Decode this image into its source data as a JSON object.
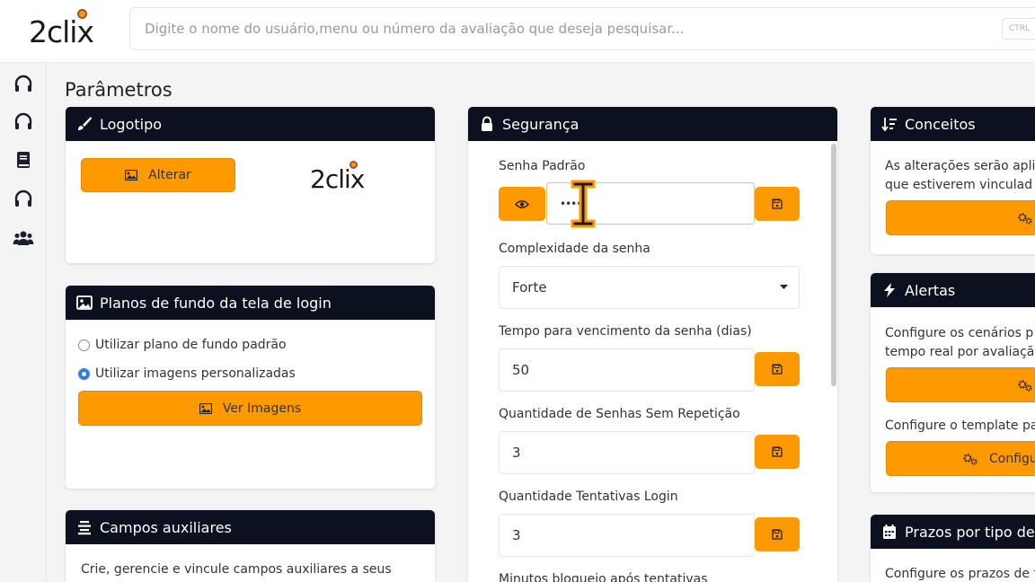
{
  "app": {
    "logo_text": "2clix",
    "search_placeholder": "Digite o nome do usuário,menu ou número da avaliação que deseja pesquisar...",
    "search_shortcut": "CTRL"
  },
  "sidebar": {
    "items": [
      {
        "icon": "headset-icon"
      },
      {
        "icon": "headset-icon"
      },
      {
        "icon": "book-icon"
      },
      {
        "icon": "headset-icon"
      },
      {
        "icon": "users-icon"
      }
    ]
  },
  "page": {
    "title": "Parâmetros"
  },
  "logotipo": {
    "title": "Logotipo",
    "alterar_label": "Alterar",
    "preview_text": "2clix"
  },
  "planos": {
    "title": "Planos de fundo da tela de login",
    "option_default": "Utilizar plano de fundo padrão",
    "option_custom": "Utilizar imagens personalizadas",
    "selected": "Utilizar imagens personalizadas",
    "ver_imagens_label": "Ver Imagens"
  },
  "campos": {
    "title": "Campos auxiliares",
    "description": "Crie, gerencie e vincule campos auxiliares a seus"
  },
  "seguranca": {
    "title": "Segurança",
    "senha_padrao_label": "Senha Padrão",
    "senha_padrao_value": "••••",
    "complexidade_label": "Complexidade da senha",
    "complexidade_value": "Forte",
    "vencimento_label": "Tempo para vencimento da senha (dias)",
    "vencimento_value": "50",
    "sem_repeticao_label": "Quantidade de Senhas Sem Repetição",
    "sem_repeticao_value": "3",
    "tentativas_label": "Quantidade Tentativas Login",
    "tentativas_value": "3",
    "minutos_label": "Minutos bloqueio após tentativas"
  },
  "conceitos": {
    "title": "Conceitos",
    "description_line1": "As alterações serão apli",
    "description_line2": "que estiverem vinculad"
  },
  "alertas": {
    "title": "Alertas",
    "description_line1": "Configure os cenários p",
    "description_line2": "tempo real por avaliaçã",
    "template_text": "Configure o template pa",
    "config_label": "Configu"
  },
  "prazos": {
    "title": "Prazos por tipo de f",
    "description": "Configure os prazos de f"
  },
  "colors": {
    "accent": "#ff9900",
    "header_bg": "#0c111f"
  }
}
